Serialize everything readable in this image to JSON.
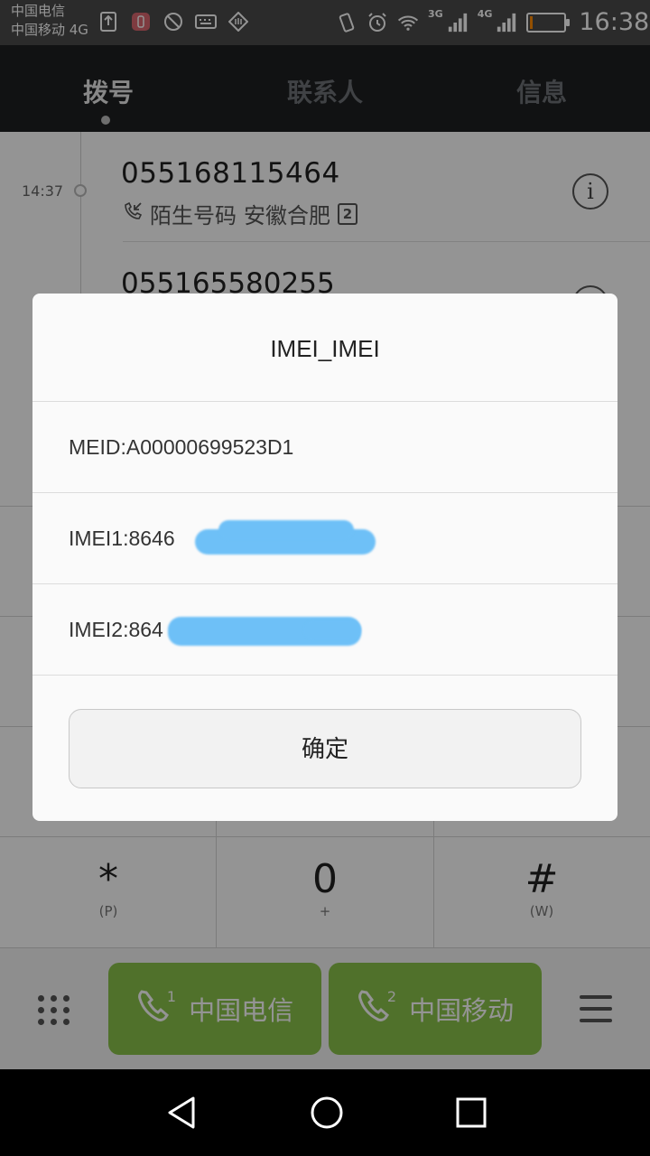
{
  "status_bar": {
    "carrier_1": "中国电信",
    "carrier_2": "中国移动 4G",
    "net_3g": "3G",
    "net_4g": "4G",
    "time": "16:38",
    "battery_percent": 8,
    "battery_color": "#ff8a00"
  },
  "tabs": [
    {
      "label": "拨号",
      "active": true
    },
    {
      "label": "联系人",
      "active": false
    },
    {
      "label": "信息",
      "active": false
    }
  ],
  "call_log": [
    {
      "time": "14:37",
      "number": "055168115464",
      "tag": "陌生号码",
      "location": "安徽合肥",
      "sim": "2"
    },
    {
      "number": "055165580255"
    }
  ],
  "keypad": {
    "star": {
      "main": "*",
      "sub": "(P)"
    },
    "zero": {
      "main": "0",
      "sub": "+"
    },
    "hash": {
      "main": "#",
      "sub": "(W)"
    }
  },
  "dial_buttons": [
    {
      "sim": "1",
      "label": "中国电信"
    },
    {
      "sim": "2",
      "label": "中国移动"
    }
  ],
  "dialog": {
    "title": "IMEI_IMEI",
    "meid": "MEID:A00000699523D1",
    "imei1": "IMEI1:8646",
    "imei2": "IMEI2:864",
    "confirm": "确定"
  },
  "colors": {
    "dial_green": "#8bc34a",
    "redaction_blue": "#6ec0f7",
    "tabbar_bg": "#1e2022"
  },
  "icons": [
    "alarm-icon",
    "wifi-icon",
    "signal-icon",
    "vibrate-icon",
    "incoming-call-icon",
    "info-icon",
    "dialpad-icon",
    "phone-icon",
    "menu-icon",
    "back-icon",
    "home-icon",
    "recents-icon"
  ]
}
